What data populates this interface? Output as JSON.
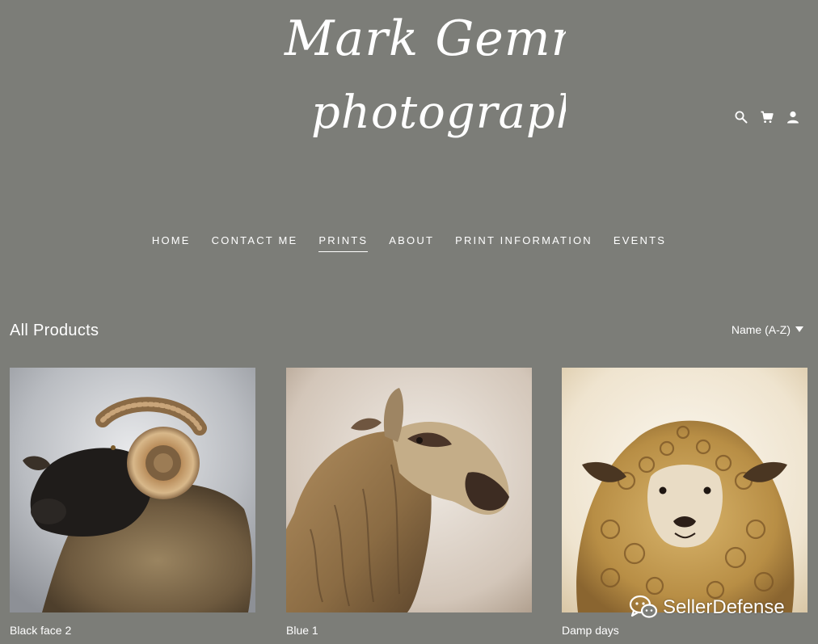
{
  "logo": {
    "line1": "Mark Gemmell",
    "line2": "photography"
  },
  "utility_icons": [
    "search-icon",
    "cart-icon",
    "account-icon"
  ],
  "nav": {
    "items": [
      {
        "label": "HOME"
      },
      {
        "label": "CONTACT ME"
      },
      {
        "label": "PRINTS",
        "active": true
      },
      {
        "label": "ABOUT"
      },
      {
        "label": "PRINT INFORMATION"
      },
      {
        "label": "EVENTS"
      }
    ]
  },
  "products": {
    "title": "All Products",
    "sort_label": "Name (A-Z)",
    "items": [
      {
        "name": "Black face 2"
      },
      {
        "name": "Blue 1"
      },
      {
        "name": "Damp days"
      }
    ]
  },
  "watermark": {
    "text": "SellerDefense"
  },
  "colors": {
    "background": "#7c7d78",
    "text": "#ffffff"
  }
}
